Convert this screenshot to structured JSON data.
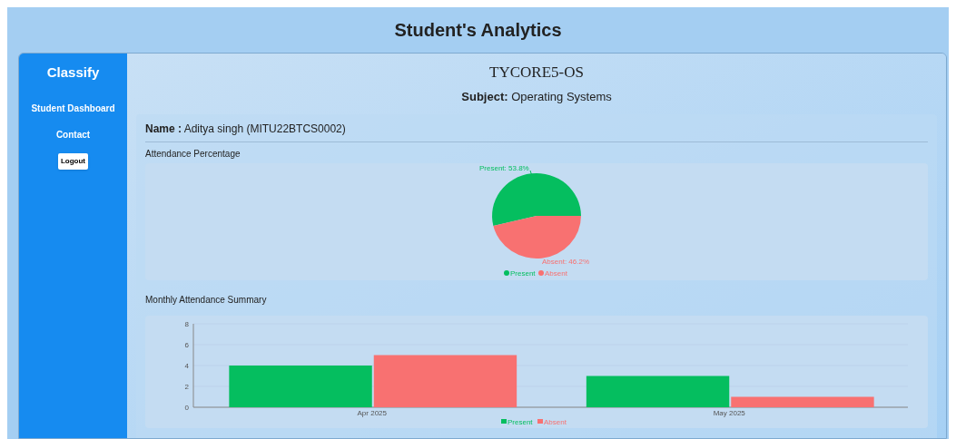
{
  "page_title": "Student's Analytics",
  "sidebar": {
    "brand": "Classify",
    "links": [
      "Student Dashboard",
      "Contact"
    ],
    "logout": "Logout"
  },
  "course": {
    "code": "TYCORE5-OS",
    "subject_label": "Subject:",
    "subject": "Operating Systems"
  },
  "student": {
    "label": "Name :",
    "value": "Aditya singh (MITU22BTCS0002)"
  },
  "attendance": {
    "title": "Attendance Percentage",
    "chart_data": {
      "type": "pie",
      "categories": [
        "Present",
        "Absent"
      ],
      "values": [
        53.8,
        46.2
      ],
      "colors": [
        "#05be5f",
        "#f87171"
      ],
      "value_labels": [
        "Present: 53.8%",
        "Absent: 46.2%"
      ],
      "legend": "bottom"
    }
  },
  "monthly": {
    "title": "Monthly Attendance Summary",
    "chart_data": {
      "type": "bar",
      "categories": [
        "Apr 2025",
        "May 2025"
      ],
      "series": [
        {
          "name": "Present",
          "color": "#05be5f",
          "values": [
            4,
            3
          ]
        },
        {
          "name": "Absent",
          "color": "#f87171",
          "values": [
            5,
            1
          ]
        }
      ],
      "ylim": [
        0,
        8
      ],
      "yticks": [
        0,
        2,
        4,
        6,
        8
      ],
      "legend": "bottom"
    }
  }
}
